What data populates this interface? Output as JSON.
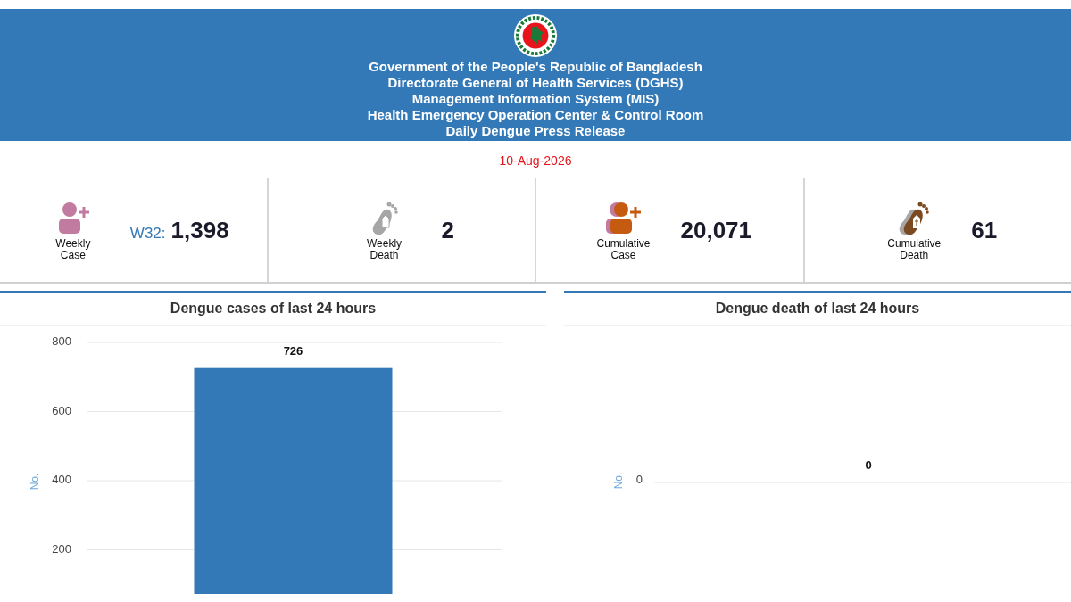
{
  "header": {
    "lines": [
      "Government of the People's Republic of Bangladesh",
      "Directorate General of Health Services (DGHS)",
      "Management Information System (MIS)",
      "Health Emergency Operation Center & Control Room",
      "Daily Dengue Press Release"
    ]
  },
  "date": "10-Aug-2026",
  "stats": [
    {
      "kind": "person",
      "color": "#c27ba0",
      "label": "Weekly Case",
      "prefix": "W32:",
      "value": "1,398"
    },
    {
      "kind": "foot",
      "color": "#a6a6a6",
      "label": "Weekly Death",
      "value": "2"
    },
    {
      "kind": "people",
      "color": "#c55a11",
      "label": "Cumulative Case",
      "value": "20,071"
    },
    {
      "kind": "feet",
      "color": "#7b4a20",
      "label": "Cumulative Death",
      "value": "61"
    }
  ],
  "charts": [
    {
      "chart_data": {
        "type": "bar",
        "title": "Dengue cases of last 24 hours",
        "ylabel": "No.",
        "ylim": [
          0,
          800
        ],
        "grid": true,
        "yticks": [
          200,
          400,
          600,
          800
        ],
        "values": [
          726
        ],
        "data_labels": true
      }
    },
    {
      "title": "Dengue death of last 24 hours",
      "ylabel": "No.",
      "ytick": "0",
      "bar_label": "0"
    }
  ]
}
